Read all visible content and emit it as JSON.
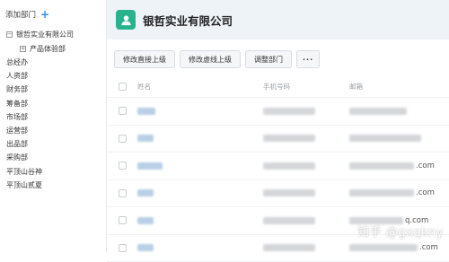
{
  "sidebar": {
    "add_label": "添加部门",
    "add_icon": "+",
    "root": {
      "label": "银哲实业有限公司",
      "toggle": "−"
    },
    "expandable_child": {
      "label": "产品体验部",
      "toggle": "+"
    },
    "items": [
      "总经办",
      "人资部",
      "财务部",
      "筹备部",
      "市场部",
      "运营部",
      "出品部",
      "采购部",
      "平顶山谷神",
      "平顶山贰夏"
    ]
  },
  "header": {
    "title": "银哲实业有限公司",
    "avatar_color": "#27b38d"
  },
  "toolbar": {
    "edit_direct_superior": "修改直接上级",
    "edit_dotted_superior": "修改虚线上级",
    "adjust_department": "调整部门",
    "more": "···"
  },
  "table": {
    "columns": {
      "name": "姓名",
      "phone": "手机号码",
      "email": "邮箱"
    },
    "rows": [
      {
        "email_suffix": ""
      },
      {
        "email_suffix": ""
      },
      {
        "email_suffix": ".com"
      },
      {
        "email_suffix": ".com"
      },
      {
        "email_suffix": "q.com"
      },
      {
        "email_suffix": ".com"
      }
    ]
  },
  "watermark": "知乎 @gxqkny",
  "colors": {
    "accent": "#2d8cf0",
    "header_bg": "#eef3f8"
  }
}
